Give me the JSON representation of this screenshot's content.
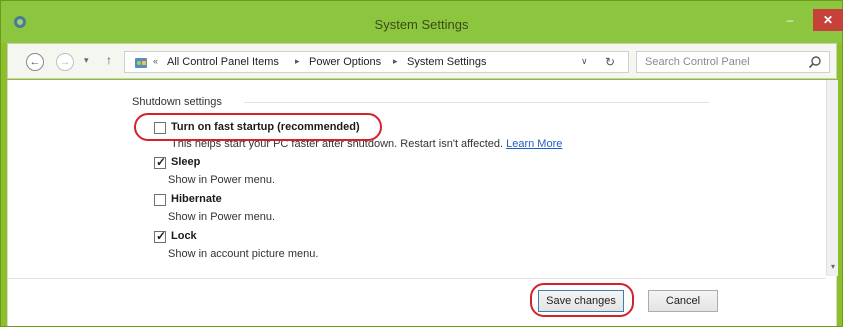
{
  "window": {
    "title": "System Settings"
  },
  "titlebar": {
    "min_label": "–",
    "max_label": "□",
    "close_label": "✕"
  },
  "nav": {
    "back_label": "←",
    "forward_label": "→",
    "history_label": "▾",
    "up_label": "↑"
  },
  "breadcrumb": {
    "prefix": "«",
    "items": [
      "All Control Panel Items",
      "Power Options",
      "System Settings"
    ],
    "separator": "▸",
    "dropdown_label": "∨",
    "refresh_label": "↻"
  },
  "search": {
    "placeholder": "Search Control Panel"
  },
  "shutdown": {
    "group_title": "Shutdown settings",
    "options": [
      {
        "label": "Turn on fast startup (recommended)",
        "checked": false,
        "description": "This helps start your PC faster after shutdown. Restart isn't affected.",
        "link": "Learn More"
      },
      {
        "label": "Sleep",
        "checked": true,
        "description": "Show in Power menu."
      },
      {
        "label": "Hibernate",
        "checked": false,
        "description": "Show in Power menu."
      },
      {
        "label": "Lock",
        "checked": true,
        "description": "Show in account picture menu."
      }
    ]
  },
  "buttons": {
    "save": "Save changes",
    "cancel": "Cancel"
  },
  "scroll": {
    "down_label": "▾"
  },
  "colors": {
    "titlebar": "#8cc63f",
    "close": "#c7413b",
    "highlight": "#d3222a",
    "link": "#1f5fbf"
  }
}
